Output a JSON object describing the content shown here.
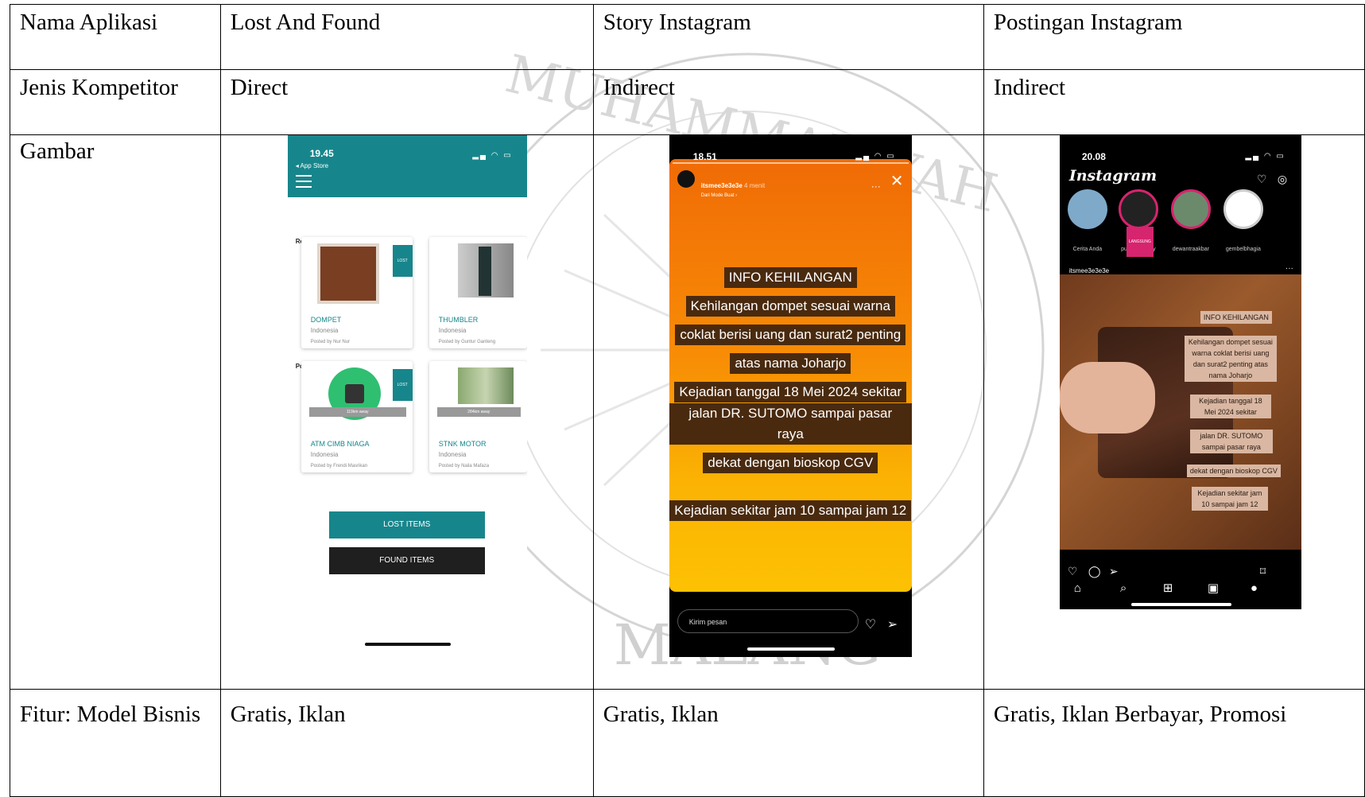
{
  "table": {
    "rows": [
      {
        "label": "Nama Aplikasi",
        "cells": [
          "Lost And Found",
          "Story Instagram",
          "Postingan Instagram"
        ]
      },
      {
        "label": "Jenis Kompetitor",
        "cells": [
          "Direct",
          "Indirect",
          "Indirect"
        ]
      },
      {
        "label": "Gambar",
        "cells": [
          "",
          "",
          ""
        ]
      },
      {
        "label": "Fitur: Model Bisnis",
        "cells": [
          "Gratis, Iklan",
          "Gratis, Iklan",
          "Gratis, Iklan Berbayar, Promosi"
        ]
      }
    ]
  },
  "watermark": {
    "top": "MUHAMMADIYAH",
    "bottom": "MALANG"
  },
  "lost_found_app": {
    "time": "19.45",
    "back": "◂ App Store",
    "recent_posts": "Recent Posts",
    "post_near_me": "Post Near Me",
    "cards": [
      {
        "tag": "LOST",
        "title": "DOMPET",
        "location": "Indonesia",
        "poster": "Posted by Nur Nur",
        "distance": ""
      },
      {
        "tag": "",
        "title": "THUMBLER",
        "location": "Indonesia",
        "poster": "Posted by Guntur Ganteng",
        "distance": ""
      },
      {
        "tag": "LOST",
        "title": "ATM CIMB NIAGA",
        "location": "Indonesia",
        "poster": "Posted by Frendi Masrikan",
        "distance": "119km away"
      },
      {
        "tag": "",
        "title": "STNK MOTOR",
        "location": "Indonesia",
        "poster": "Posted by Naila Mafaza",
        "distance": "284km away"
      }
    ],
    "lost_button": "LOST ITEMS",
    "found_button": "FOUND ITEMS"
  },
  "story_app": {
    "time": "18.51",
    "user": "itsmee3e3e3e",
    "age": "4 menit",
    "subtitle": "Dari Mode Buat ›",
    "text_lines": [
      "INFO KEHILANGAN",
      "Kehilangan dompet sesuai warna",
      "coklat berisi uang dan surat2 penting",
      "atas nama Joharjo",
      "Kejadian tanggal 18 Mei 2024 sekitar",
      "jalan  DR. SUTOMO sampai pasar raya",
      "dekat dengan bioskop CGV"
    ],
    "text_extra": "Kejadian sekitar jam 10 sampai jam 12",
    "reply_placeholder": "Kirim pesan"
  },
  "feed_app": {
    "time": "20.08",
    "brand": "Instagram",
    "stories": [
      {
        "name": "Cerita Anda",
        "live": ""
      },
      {
        "name": "putrianandaily",
        "live": "LANGSUNG"
      },
      {
        "name": "dewantraakbar",
        "live": ""
      },
      {
        "name": "gembelbhagia",
        "live": ""
      }
    ],
    "post_user": "itsmee3e3e3e",
    "labels": [
      "INFO KEHILANGAN",
      "Kehilangan dompet sesuai warna coklat berisi uang dan surat2 penting atas nama Joharjo",
      "Kejadian tanggal 18 Mei 2024 sekitar",
      "jalan DR. SUTOMO sampai pasar raya",
      "dekat dengan bioskop CGV",
      "Kejadian sekitar jam 10 sampai jam 12"
    ]
  }
}
